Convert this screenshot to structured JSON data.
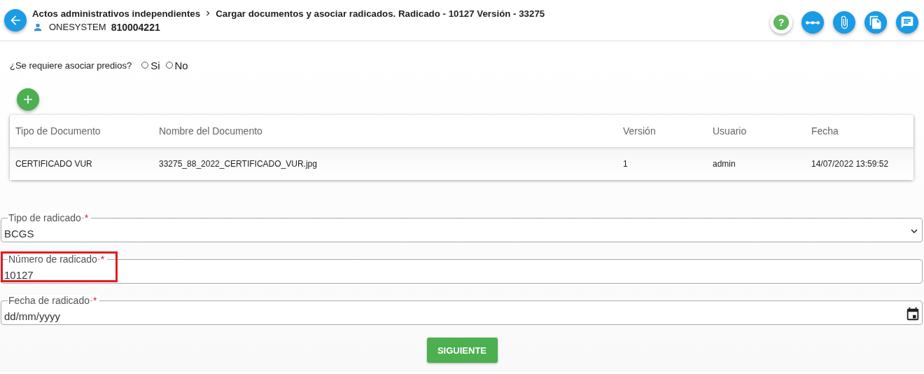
{
  "header": {
    "breadcrumb": "Actos administrativos independientes",
    "title": "Cargar documentos y asociar radicados. Radicado - 10127 Versión - 33275",
    "user": "ONESYSTEM",
    "user_id": "810004221",
    "help_label": "?"
  },
  "question": {
    "label": "¿Se requiere asociar predios?",
    "options": [
      {
        "label": "Si",
        "selected": false
      },
      {
        "label": "No",
        "selected": false
      }
    ]
  },
  "table": {
    "columns": [
      "Tipo de Documento",
      "Nombre del Documento",
      "Versión",
      "Usuario",
      "Fecha"
    ],
    "rows": [
      [
        "CERTIFICADO VUR",
        "33275_88_2022_CERTIFICADO_VUR.jpg",
        "1",
        "admin",
        "14/07/2022 13:59:52"
      ]
    ]
  },
  "fields": [
    {
      "kind": "select",
      "label": "Tipo de radicado",
      "required_mark": "*",
      "value": "BCGS"
    },
    {
      "kind": "text",
      "label": "Número de radicado",
      "required_mark": "*",
      "value": "10127",
      "highlighted": true
    },
    {
      "kind": "date",
      "label": "Fecha de radicado",
      "required_mark": "*",
      "placeholder": "dd/mm/yyyy"
    }
  ],
  "submit": "SIGUIENTE"
}
